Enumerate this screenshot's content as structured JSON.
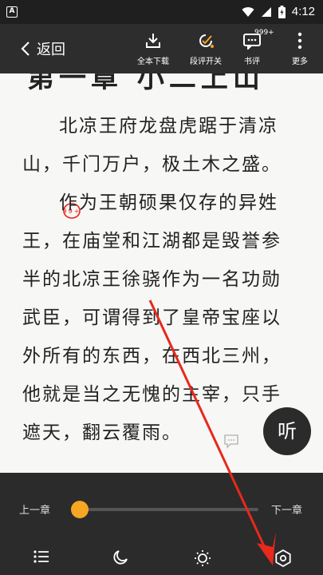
{
  "status_bar": {
    "app_badge": "A",
    "time": "4:12",
    "icons": [
      "wifi-icon",
      "signal-icon",
      "battery-icon"
    ]
  },
  "header": {
    "back_label": "返回",
    "tools": [
      {
        "label": "全本下载",
        "icon": "download-icon"
      },
      {
        "label": "段评开关",
        "icon": "comment-toggle-icon"
      },
      {
        "label": "书评",
        "icon": "book-review-icon",
        "badge": "999+"
      },
      {
        "label": "更多",
        "icon": "more-icon"
      }
    ]
  },
  "reader": {
    "chapter_title": "第一章 小二上山",
    "paragraphs": [
      {
        "text": "北凉王府龙盘虎踞于清凉山，千门万户，极土木之盛。",
        "comment_badge": "99+"
      },
      {
        "text": "作为王朝硕果仅存的异姓王，在庙堂和江湖都是毁誉参半的北凉王徐骁作为一名功勋武臣，可谓得到了皇帝宝座以外所有的东西，在西北三州，他就是当之无愧的主宰，只手遮天，翻云覆雨。",
        "comment_badge": ""
      }
    ],
    "listen_label": "听"
  },
  "bottom": {
    "prev_label": "上一章",
    "next_label": "下一章",
    "progress": 0.0,
    "icons": [
      "catalog-icon",
      "night-mode-icon",
      "brightness-icon",
      "settings-icon"
    ]
  },
  "colors": {
    "accent": "#f5a623",
    "arrow": "#e8291c",
    "panel": "#2b2b2b",
    "page": "#f7f7f5"
  }
}
